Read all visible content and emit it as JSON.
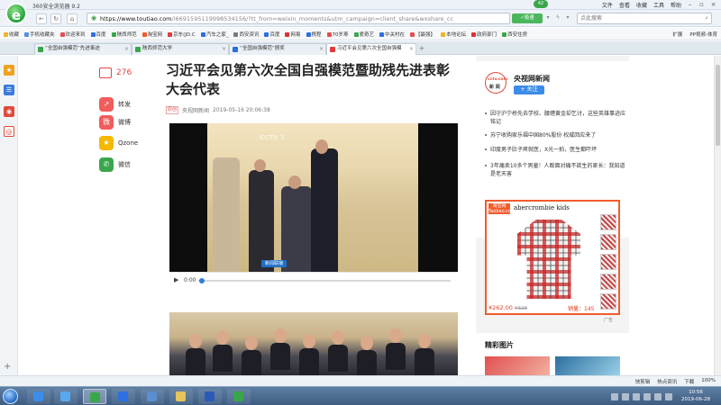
{
  "browser": {
    "title": "360安全浏览器 9.2",
    "menu": [
      "文件",
      "查看",
      "收藏",
      "工具",
      "帮助"
    ],
    "score_badge": "42",
    "address": {
      "domain": "https://www.toutiao.com",
      "path": "/i6691595119998534156/?tt_from=weixin_moments&utm_campaign=client_share&wxshare_cc"
    },
    "speed_badge": "✓极速",
    "search_placeholder": "点此搜索",
    "bookmarks": [
      {
        "label": "收藏",
        "color": "#f0b429"
      },
      {
        "label": "手机收藏夹",
        "color": "#5b8fd9"
      },
      {
        "label": "欢迎来到",
        "color": "#e05050"
      },
      {
        "label": "百度",
        "color": "#2c6fe0"
      },
      {
        "label": "陕西师范",
        "color": "#3aa64b"
      },
      {
        "label": "淘宝网",
        "color": "#f25c2c"
      },
      {
        "label": "京东(JD.C",
        "color": "#e23a3a"
      },
      {
        "label": "汽车之家_",
        "color": "#2c6fe0"
      },
      {
        "label": "西安资讯",
        "color": "#7b7b7b"
      },
      {
        "label": "百度",
        "color": "#2c6fe0"
      },
      {
        "label": "网易",
        "color": "#d33"
      },
      {
        "label": "携程",
        "color": "#2c6fe0"
      },
      {
        "label": "70岁寿",
        "color": "#e05050"
      },
      {
        "label": "爱奇艺",
        "color": "#3aa64b"
      },
      {
        "label": "中关村在",
        "color": "#2c6fe0"
      },
      {
        "label": "【最强】",
        "color": "#e05050"
      },
      {
        "label": "本地论坛",
        "color": "#f0b429"
      },
      {
        "label": "政府部门",
        "color": "#d33"
      },
      {
        "label": "西安住房",
        "color": "#3aa64b"
      }
    ],
    "bookmarks_right": [
      "扩展",
      "PP视频-体育"
    ],
    "tabs": [
      {
        "label": "“全国自强模范”先进事迹",
        "color": "#3aa64b",
        "active": false
      },
      {
        "label": "陕西师范大学",
        "color": "#3aa64b",
        "active": false
      },
      {
        "label": "“全国自强模范”颁奖",
        "color": "#2c6fe0",
        "active": false
      },
      {
        "label": "习近平会见第六次全国自强模",
        "color": "#e23a3a",
        "active": true
      }
    ],
    "status": [
      "快剪辑",
      "热点资讯",
      "下载",
      "100%"
    ]
  },
  "article": {
    "comments_count": "276",
    "share": [
      {
        "label": "转发",
        "icon": "forward-icon",
        "color": "#f25c5c",
        "glyph": "↗"
      },
      {
        "label": "微博",
        "icon": "weibo-icon",
        "color": "#f25c5c",
        "glyph": "微"
      },
      {
        "label": "Qzone",
        "icon": "qzone-icon",
        "color": "#f5b800",
        "glyph": "★"
      },
      {
        "label": "微信",
        "icon": "wechat-icon",
        "color": "#3aa64b",
        "glyph": "✆"
      }
    ],
    "title": "习近平会见第六次全国自强模范暨助残先进表彰大会代表",
    "tag": "原创",
    "source": "央视网新闻",
    "time": "2019-05-16 20:06:38",
    "video": {
      "channel": "CCTV 1",
      "news_badge": "新闻联播",
      "current_time": "0:00",
      "progress": 0
    }
  },
  "sidebar": {
    "media": {
      "logo_top": "cctv.com",
      "logo_bottom": "新 闻",
      "name": "央视网新闻",
      "follow_label": "+ 关注"
    },
    "headlines": [
      "因守沪宁桥先去学校、腰缠黄金却乞讨，这些英雄事迹应铭记",
      "苏宁收购家乐福中国80%股份 权威回应来了",
      "印度男子肚子疼就医，X光一拍，医生都吓坏",
      "3年痛卖10多个男童！人贩面对痛不欲生的家长：我知道是老天害"
    ],
    "ad": {
      "platform": "淘宝网 Taobao.com",
      "brand": "abercrombie kids",
      "price": "¥262.00",
      "old_price": "¥328",
      "sales": "销量：145",
      "ad_mark": "广告"
    },
    "pictures_title": "精彩图片"
  },
  "taskbar": {
    "time": "10:56",
    "date": "2019-06-28"
  }
}
